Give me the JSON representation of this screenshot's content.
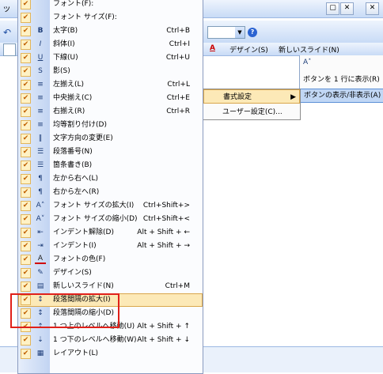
{
  "background": {
    "undo_glyph": "↶",
    "left_char": "ツ",
    "status_left_char": "カ",
    "font_color_glyph": "A",
    "design_button": "デザイン(S)",
    "new_slide_button": "新しいスライド(N)",
    "help_glyph": "?",
    "window_buttons": [
      "▢",
      "✕",
      "✕"
    ]
  },
  "flyout": {
    "items": [
      {
        "icon": "A˟",
        "label": ""
      },
      {
        "icon": "",
        "label": "ボタンを 1 行に表示(R)"
      },
      {
        "icon": "",
        "label": "ボタンの表示/非表示(A) ▾"
      }
    ]
  },
  "context_menu": {
    "items": [
      {
        "label": "書式設定",
        "arrow": "▶"
      },
      {
        "label": "ユーザー設定(C)..."
      }
    ]
  },
  "menu": {
    "items": [
      {
        "icon": "",
        "label": "フォント(F):",
        "shortcut": ""
      },
      {
        "icon": "",
        "label": "フォント サイズ(F):",
        "shortcut": ""
      },
      {
        "icon": "B",
        "label": "太字(B)",
        "shortcut": "Ctrl+B"
      },
      {
        "icon": "I",
        "label": "斜体(I)",
        "shortcut": "Ctrl+I"
      },
      {
        "icon": "U",
        "label": "下線(U)",
        "shortcut": "Ctrl+U"
      },
      {
        "icon": "S",
        "label": "影(S)",
        "shortcut": ""
      },
      {
        "icon": "≡",
        "label": "左揃え(L)",
        "shortcut": "Ctrl+L"
      },
      {
        "icon": "≡",
        "label": "中央揃え(C)",
        "shortcut": "Ctrl+E"
      },
      {
        "icon": "≡",
        "label": "右揃え(R)",
        "shortcut": "Ctrl+R"
      },
      {
        "icon": "≡",
        "label": "均等割り付け(D)",
        "shortcut": ""
      },
      {
        "icon": "‖",
        "label": "文字方向の変更(E)",
        "shortcut": ""
      },
      {
        "icon": "☰",
        "label": "段落番号(N)",
        "shortcut": ""
      },
      {
        "icon": "☰",
        "label": "箇条書き(B)",
        "shortcut": ""
      },
      {
        "icon": "¶",
        "label": "左から右へ(L)",
        "shortcut": ""
      },
      {
        "icon": "¶",
        "label": "右から左へ(R)",
        "shortcut": ""
      },
      {
        "icon": "A˄",
        "label": "フォント サイズの拡大(I)",
        "shortcut": "Ctrl+Shift+>"
      },
      {
        "icon": "A˅",
        "label": "フォント サイズの縮小(D)",
        "shortcut": "Ctrl+Shift+<"
      },
      {
        "icon": "⇤",
        "label": "インデント解除(D)",
        "shortcut": "Alt + Shift + ←"
      },
      {
        "icon": "⇥",
        "label": "インデント(I)",
        "shortcut": "Alt + Shift + →"
      },
      {
        "icon": "A",
        "label": "フォントの色(F)",
        "shortcut": ""
      },
      {
        "icon": "✎",
        "label": "デザイン(S)",
        "shortcut": ""
      },
      {
        "icon": "▤",
        "label": "新しいスライド(N)",
        "shortcut": "Ctrl+M"
      },
      {
        "icon": "↕",
        "label": "段落間隔の拡大(I)",
        "shortcut": ""
      },
      {
        "icon": "↕",
        "label": "段落間隔の縮小(D)",
        "shortcut": ""
      },
      {
        "icon": "⇡",
        "label": "1 つ上のレベルへ移動(U)",
        "shortcut": "Alt + Shift + ↑"
      },
      {
        "icon": "⇣",
        "label": "1 つ下のレベルへ移動(W)",
        "shortcut": "Alt + Shift + ↓"
      },
      {
        "icon": "▦",
        "label": "レイアウト(L)",
        "shortcut": ""
      }
    ],
    "check_glyph": "✔"
  },
  "colors": {
    "accent_highlight": "#fce9b7",
    "annotation_red": "#e0201a",
    "menu_gutter": "#c2d4f2"
  }
}
